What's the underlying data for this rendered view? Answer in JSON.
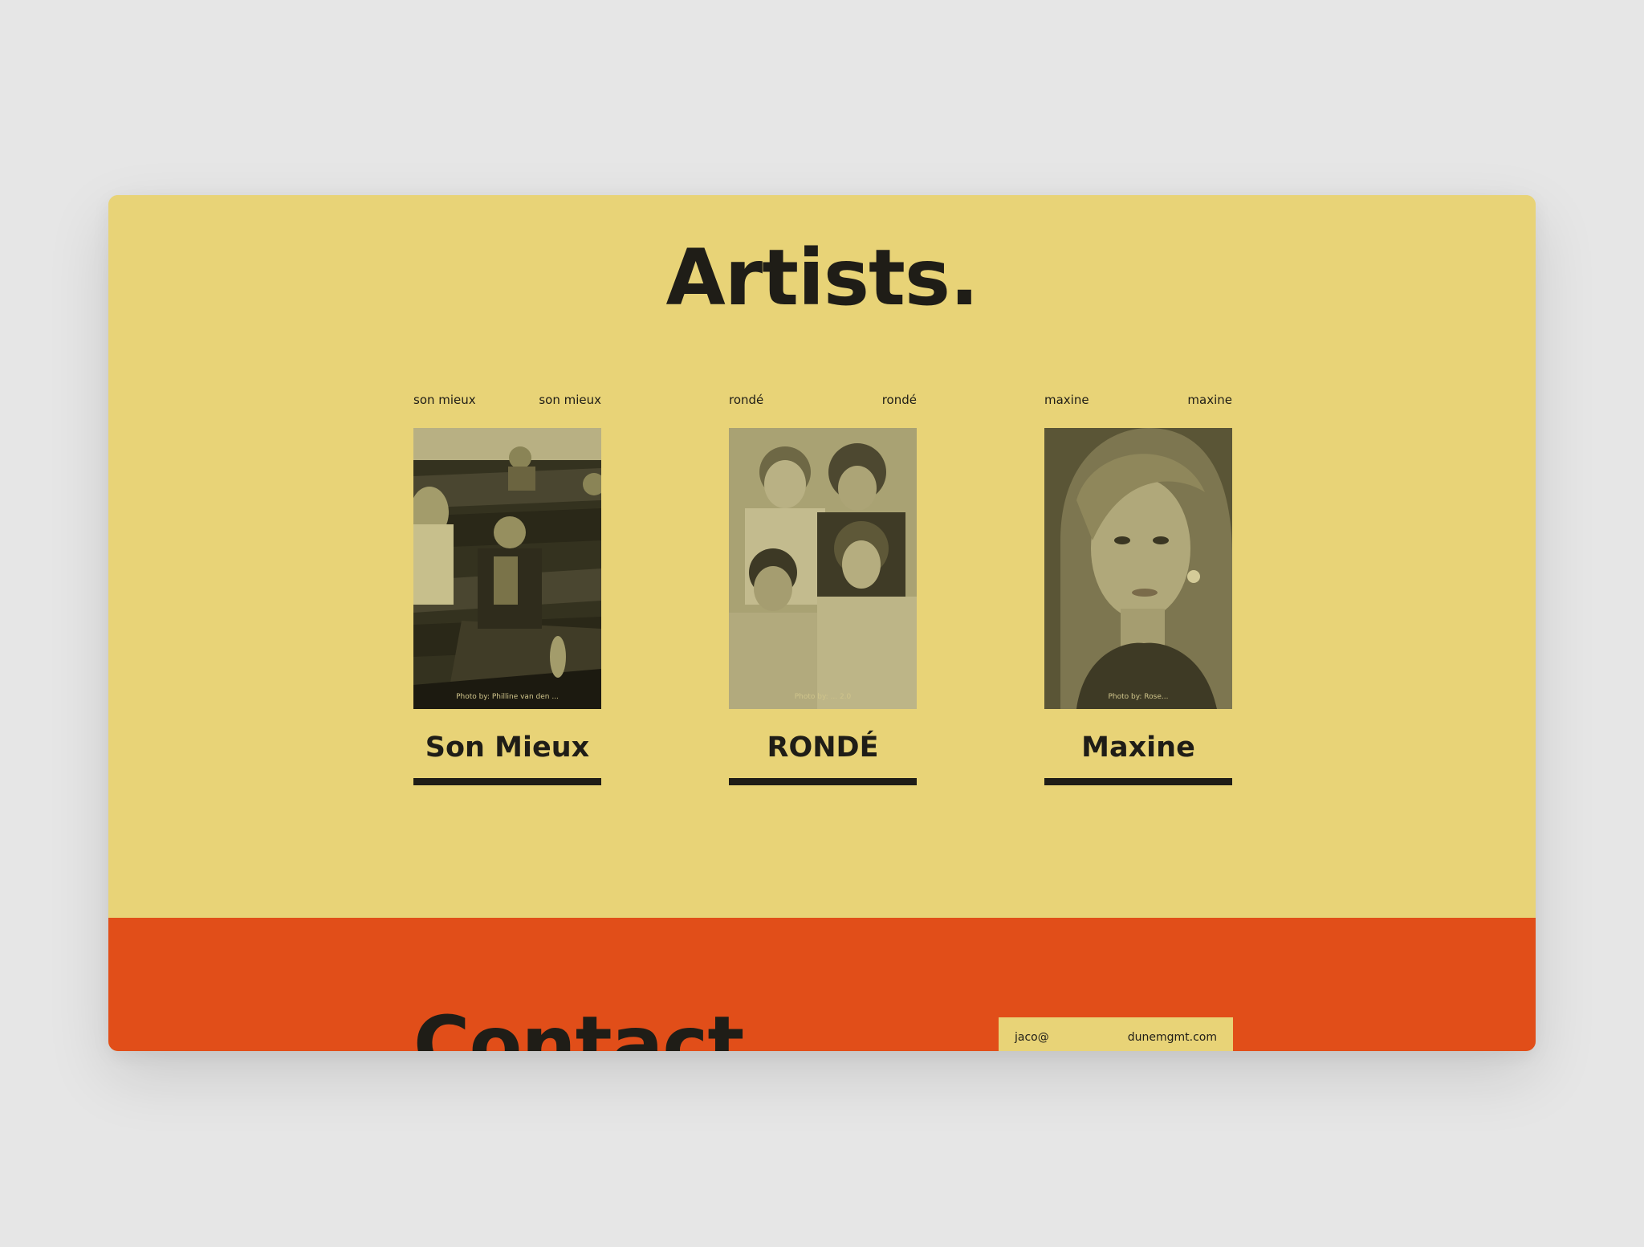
{
  "colors": {
    "background": "#e6e6e6",
    "artists_bg": "#e8d377",
    "contact_bg": "#e14e19",
    "ink": "#1f1d17"
  },
  "artists": {
    "title": "Artists.",
    "cards": [
      {
        "top_left": "son mieux",
        "top_right": "son mieux",
        "name": "Son Mieux",
        "credit": "Photo by: Philline van den ...",
        "photo_icon": "band-photo"
      },
      {
        "top_left": "rondé",
        "top_right": "rondé",
        "name": "RONDÉ",
        "credit": "Photo by: ... 2.0",
        "photo_icon": "band-photo"
      },
      {
        "top_left": "maxine",
        "top_right": "maxine",
        "name": "Maxine",
        "credit": "Photo by: Rose...",
        "photo_icon": "portrait-photo"
      }
    ]
  },
  "contact": {
    "title": "Contact",
    "email_left": "jaco@",
    "email_right": "dunemgmt.com"
  }
}
